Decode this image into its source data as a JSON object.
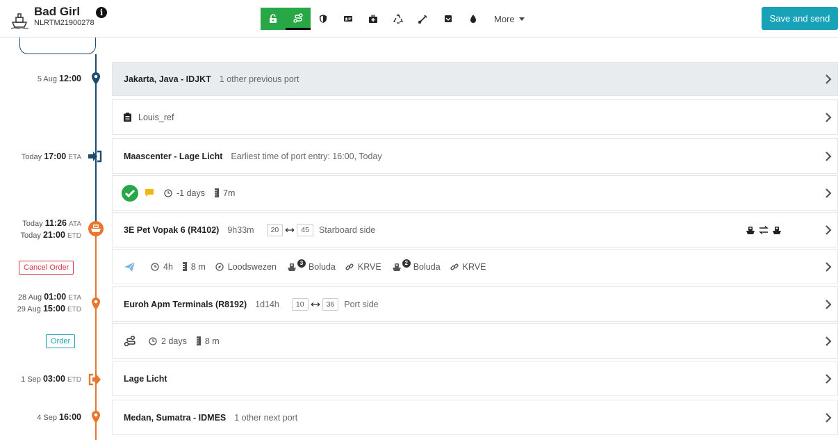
{
  "ship": {
    "name": "Bad Girl",
    "id": "NLRTM21900278"
  },
  "toolbar": {
    "icons": [
      "unlock-icon",
      "route-icon",
      "shield-icon",
      "id-card-icon",
      "medkit-icon",
      "recycle-icon",
      "syringe-icon",
      "inbox-icon",
      "fire-icon"
    ],
    "more_label": "More"
  },
  "save_label": "Save and send",
  "timeline": [
    {
      "day": "5 Aug",
      "time": "12:00"
    },
    {
      "day": "Today",
      "time": "17:00",
      "unit": "ETA"
    },
    {
      "day": "Today",
      "time": "11:26",
      "unit": "ATA"
    },
    {
      "day": "Today",
      "time": "21:00",
      "unit": "ETD"
    },
    {
      "day": "28 Aug",
      "time": "01:00",
      "unit": "ETA"
    },
    {
      "day": "29 Aug",
      "time": "15:00",
      "unit": "ETD"
    },
    {
      "day": "1 Sep",
      "time": "03:00",
      "unit": "ETD"
    },
    {
      "day": "4 Sep",
      "time": "16:00"
    }
  ],
  "buttons": {
    "cancel_order": "Cancel Order",
    "order": "Order"
  },
  "rows": {
    "prev_port": {
      "title": "Jakarta, Java - IDJKT",
      "sub": "1 other previous port"
    },
    "reference": {
      "text": "Louis_ref"
    },
    "entry": {
      "title": "Maascenter - Lage Licht",
      "sub": "Earliest time of port entry: 16:00, Today"
    },
    "entry_details": {
      "duration": "-1 days",
      "draft": "7m"
    },
    "berth1": {
      "title": "3E Pet Vopak 6 (R4102)",
      "duration": "9h33m",
      "from": "20",
      "to": "45",
      "side": "Starboard side"
    },
    "berth1_details": {
      "duration": "4h",
      "draft": "8 m",
      "pilot": "Loodswezen",
      "tug1_count": "3",
      "tug1_name": "Boluda",
      "line1": "KRVE",
      "tug2_count": "2",
      "tug2_name": "Boluda",
      "line2": "KRVE"
    },
    "berth2": {
      "title": "Euroh Apm Terminals (R8192)",
      "duration": "1d14h",
      "from": "10",
      "to": "36",
      "side": "Port side"
    },
    "berth2_details": {
      "duration": "2 days",
      "draft": "8 m"
    },
    "exit": {
      "title": "Lage Licht"
    },
    "next_port": {
      "title": "Medan, Sumatra - IDMES",
      "sub": "1 other next port"
    }
  },
  "colors": {
    "green": "#27a745",
    "teal": "#17a2b8",
    "blue_line": "#1c4b6e",
    "orange": "#e8762c",
    "red": "#dc3545"
  }
}
